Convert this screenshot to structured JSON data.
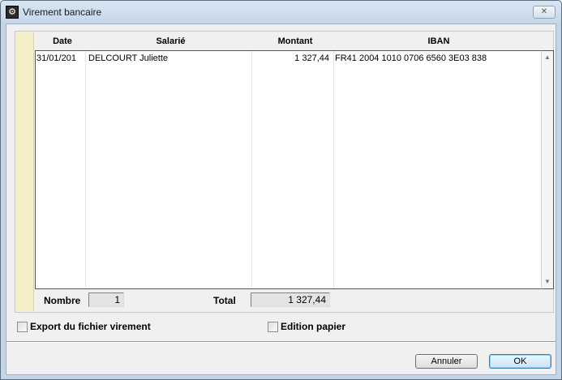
{
  "window": {
    "title": "Virement bancaire",
    "close_label": "✕",
    "app_icon": "gear-icon"
  },
  "table": {
    "headers": {
      "date": "Date",
      "employee": "Salarié",
      "amount": "Montant",
      "iban": "IBAN"
    },
    "rows": [
      {
        "date": "31/01/201",
        "employee": "DELCOURT Juliette",
        "amount": "1 327,44",
        "iban": "FR41 2004 1010 0706 6560 3E03 838"
      }
    ]
  },
  "summary": {
    "count_label": "Nombre",
    "count_value": "1",
    "total_label": "Total",
    "total_value": "1 327,44"
  },
  "options": {
    "export_label": "Export du fichier virement",
    "export_checked": false,
    "paper_label": "Edition papier",
    "paper_checked": false
  },
  "buttons": {
    "cancel": "Annuler",
    "ok": "OK"
  }
}
